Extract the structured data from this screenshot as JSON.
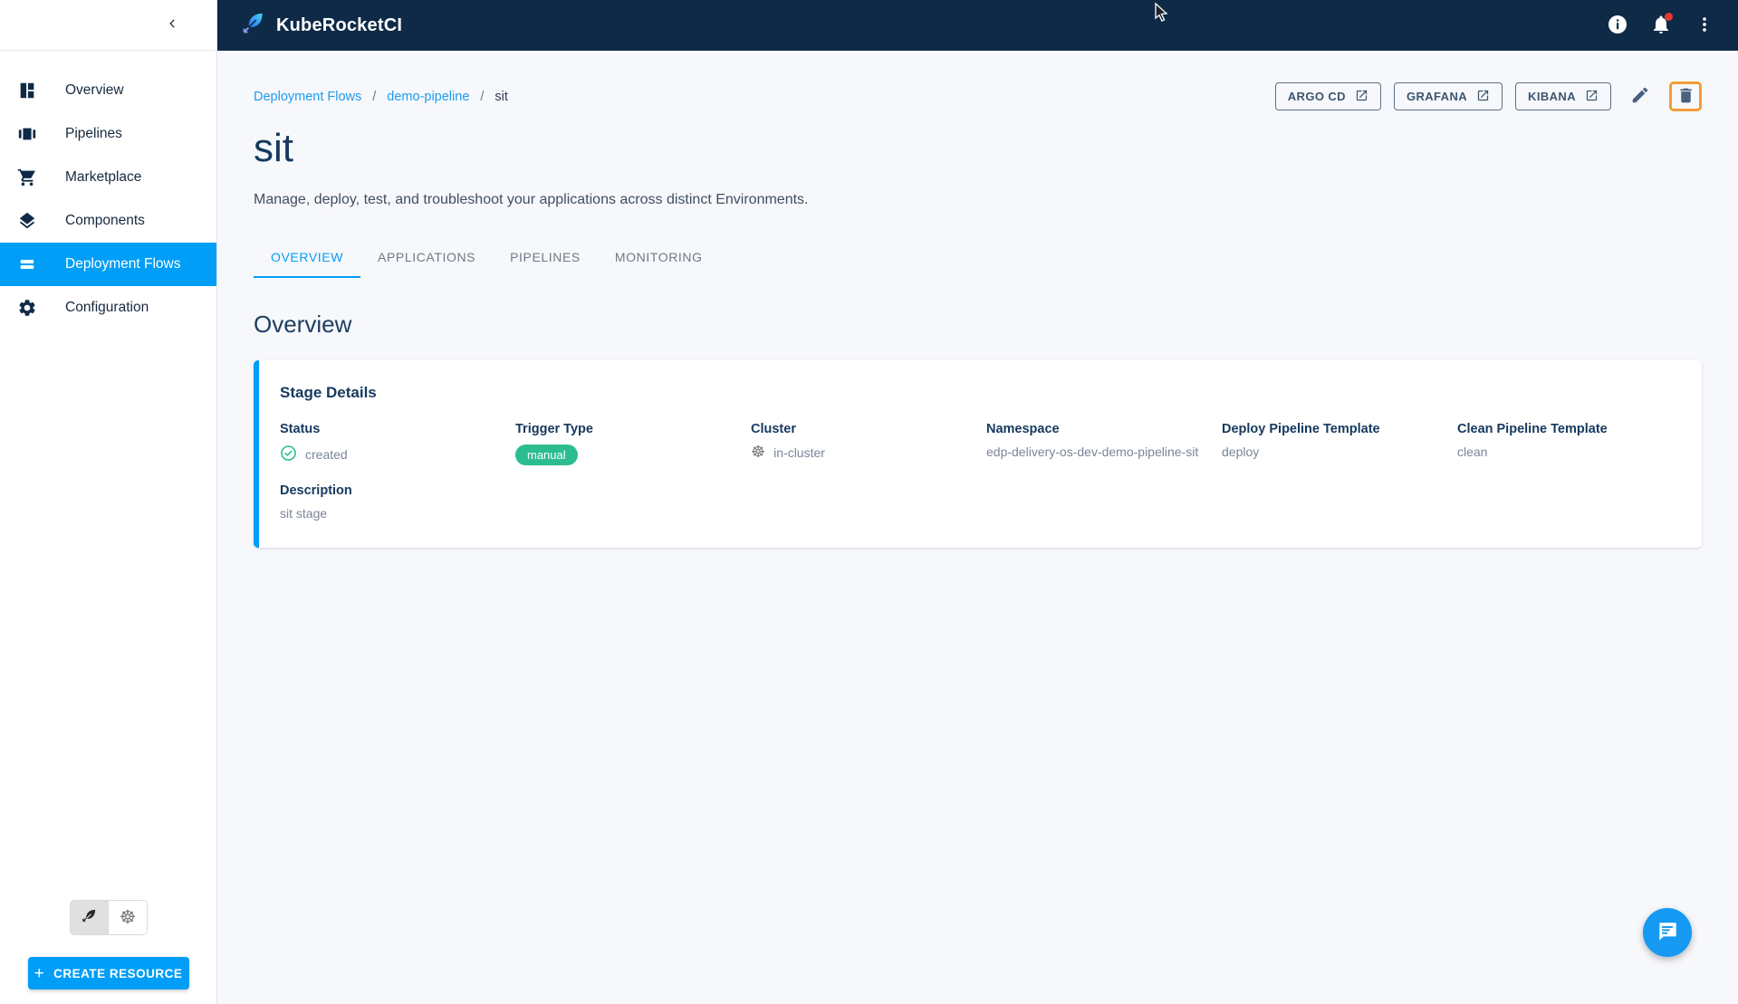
{
  "colors": {
    "primary_blue": "#009ef7",
    "appbar_navy": "#0e2a47",
    "success_green": "#2bbd90",
    "highlight_orange": "#f29c38",
    "notification_red": "#e4392f"
  },
  "appbar": {
    "title": "KubeRocketCI",
    "icons": [
      "info-icon",
      "notifications-bell-icon",
      "kebab-menu-icon"
    ]
  },
  "sidebar": {
    "items": [
      {
        "label": "Overview",
        "icon": "dashboard-icon",
        "selected": false
      },
      {
        "label": "Pipelines",
        "icon": "pipelines-icon",
        "selected": false
      },
      {
        "label": "Marketplace",
        "icon": "cart-icon",
        "selected": false
      },
      {
        "label": "Components",
        "icon": "layers-icon",
        "selected": false
      },
      {
        "label": "Deployment Flows",
        "icon": "flows-icon",
        "selected": true
      },
      {
        "label": "Configuration",
        "icon": "gear-icon",
        "selected": false
      }
    ],
    "view_toggle": [
      "kuberocketci-feather-icon",
      "kubernetes-wheel-icon"
    ],
    "create_button_label": "CREATE RESOURCE"
  },
  "breadcrumb": {
    "link1": "Deployment Flows",
    "link2": "demo-pipeline",
    "current": "sit",
    "separator": "/"
  },
  "actions": {
    "links": [
      {
        "label": "ARGO CD"
      },
      {
        "label": "GRAFANA"
      },
      {
        "label": "KIBANA"
      }
    ]
  },
  "page": {
    "title": "sit",
    "subtitle": "Manage, deploy, test, and troubleshoot your applications across distinct Environments."
  },
  "tabs": [
    {
      "label": "OVERVIEW",
      "active": true
    },
    {
      "label": "APPLICATIONS",
      "active": false
    },
    {
      "label": "PIPELINES",
      "active": false
    },
    {
      "label": "MONITORING",
      "active": false
    }
  ],
  "section_title": "Overview",
  "stage_details": {
    "card_title": "Stage Details",
    "fields": {
      "status": {
        "label": "Status",
        "value": "created"
      },
      "trigger_type": {
        "label": "Trigger Type",
        "value": "manual"
      },
      "cluster": {
        "label": "Cluster",
        "value": "in-cluster"
      },
      "namespace": {
        "label": "Namespace",
        "value": "edp-delivery-os-dev-demo-pipeline-sit"
      },
      "deploy_template": {
        "label": "Deploy Pipeline Template",
        "value": "deploy"
      },
      "clean_template": {
        "label": "Clean Pipeline Template",
        "value": "clean"
      },
      "description": {
        "label": "Description",
        "value": "sit stage"
      }
    }
  }
}
